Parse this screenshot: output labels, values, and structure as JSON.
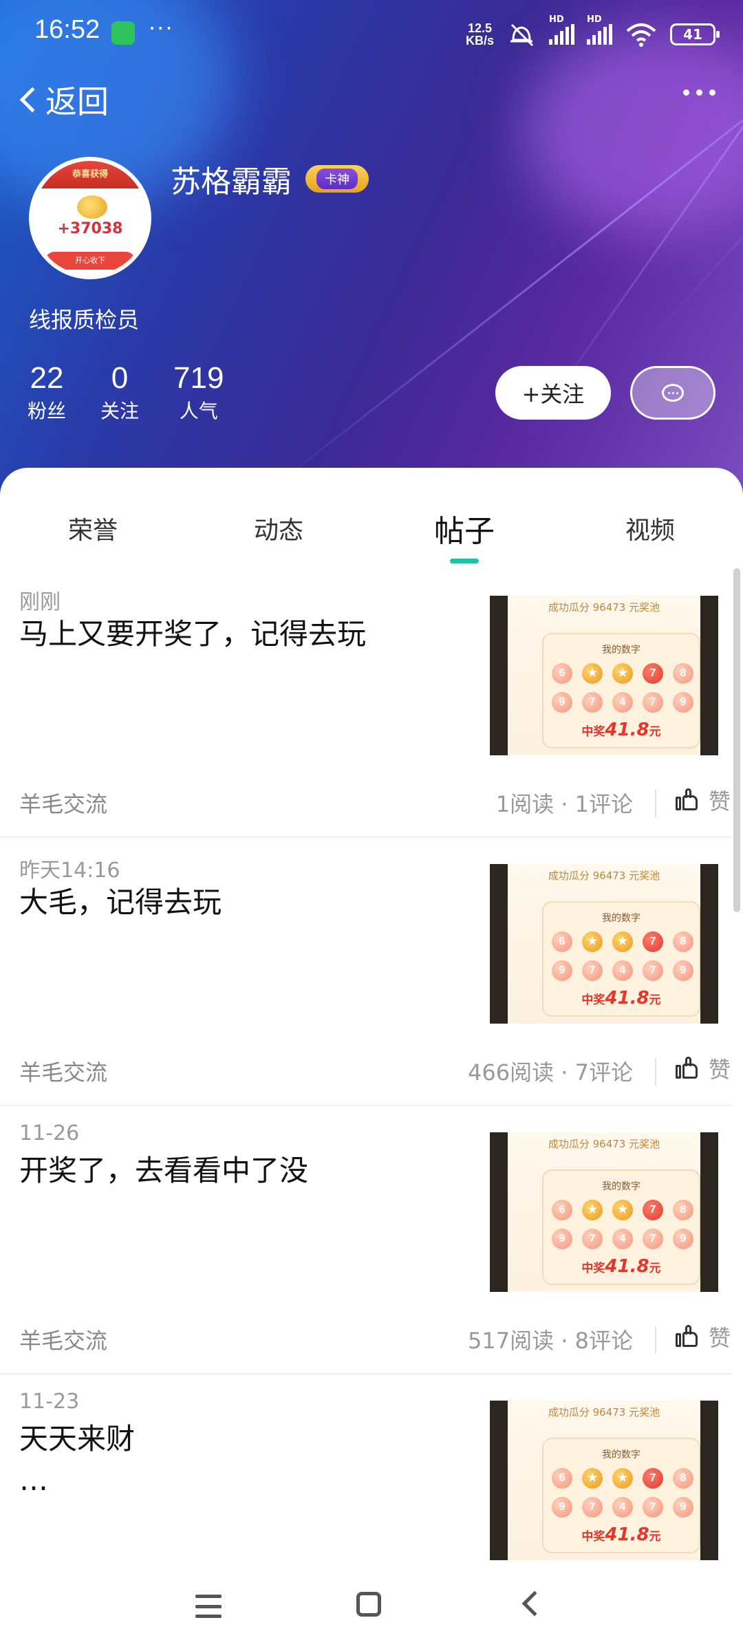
{
  "status_bar": {
    "time": "16:52",
    "dots": "···",
    "net_speed_value": "12.5",
    "net_speed_unit": "KB/s",
    "sim1": "HD",
    "sim2": "HD",
    "battery": "41"
  },
  "nav": {
    "back_label": "返回"
  },
  "profile": {
    "name": "苏格霸霸",
    "badge": "卡神",
    "title": "线报质检员",
    "avatar": {
      "header": "恭喜获得",
      "amount": "+37038",
      "button": "开心收下"
    },
    "stats": [
      {
        "value": "22",
        "label": "粉丝"
      },
      {
        "value": "0",
        "label": "关注"
      },
      {
        "value": "719",
        "label": "人气"
      }
    ],
    "follow_label": "+关注"
  },
  "tabs": [
    {
      "label": "荣誉"
    },
    {
      "label": "动态"
    },
    {
      "label": "帖子"
    },
    {
      "label": "视频"
    }
  ],
  "active_tab": "帖子",
  "thumb": {
    "pool": "成功瓜分 96473 元奖池",
    "mine": "我的数字",
    "row1": [
      "6",
      "★",
      "★",
      "7",
      "8"
    ],
    "row2": [
      "9",
      "7",
      "4",
      "7",
      "9"
    ],
    "win_prefix": "中奖",
    "win_amount": "41.8",
    "win_unit": "元"
  },
  "posts": [
    {
      "time": "刚刚",
      "title": "马上又要开奖了，记得去玩",
      "title2": "",
      "category": "羊毛交流",
      "meta": "1阅读 · 1评论",
      "like": "赞"
    },
    {
      "time": "昨天14:16",
      "title": "大毛，记得去玩",
      "title2": "",
      "category": "羊毛交流",
      "meta": "466阅读 · 7评论",
      "like": "赞"
    },
    {
      "time": "11-26",
      "title": "开奖了，去看看中了没",
      "title2": "",
      "category": "羊毛交流",
      "meta": "517阅读 · 8评论",
      "like": "赞"
    },
    {
      "time": "11-23",
      "title": "天天来财",
      "title2": "…",
      "category": "",
      "meta": "",
      "like": ""
    }
  ]
}
